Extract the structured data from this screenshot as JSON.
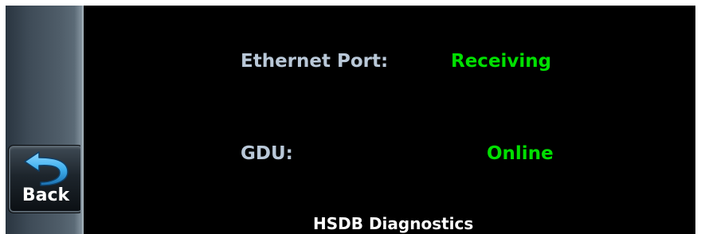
{
  "nav": {
    "back_label": "Back",
    "back_icon": "back-arrow-icon"
  },
  "status": {
    "ethernet_port_label": "Ethernet Port:",
    "ethernet_port_value": "Receiving",
    "gdu_label": "GDU:",
    "gdu_value": "Online"
  },
  "page": {
    "title": "HSDB Diagnostics"
  },
  "colors": {
    "background": "#000000",
    "label": "#b9c8d8",
    "status_ok": "#00e000",
    "title": "#ffffff",
    "icon_accent": "#3fb0ee"
  }
}
